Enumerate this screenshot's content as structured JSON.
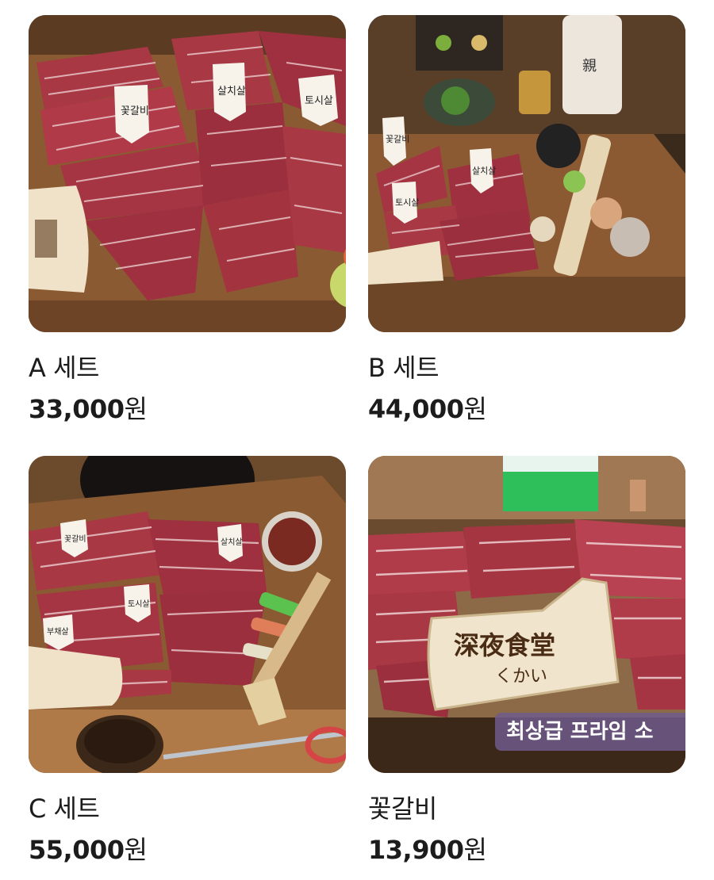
{
  "products": [
    {
      "name": "A 세트",
      "price_number": "33,000",
      "price_unit": "원",
      "photo_icon": "beef-platter-photo",
      "tags": [
        "꽃갈비",
        "살치살",
        "토시살"
      ]
    },
    {
      "name": "B 세트",
      "price_number": "44,000",
      "price_unit": "원",
      "photo_icon": "beef-platter-photo",
      "tags": [
        "꽃갈비",
        "살치살",
        "토시살"
      ]
    },
    {
      "name": "C 세트",
      "price_number": "55,000",
      "price_unit": "원",
      "photo_icon": "beef-platter-photo",
      "tags": [
        "꽃갈비",
        "살치살",
        "토시살",
        "부채살"
      ]
    },
    {
      "name": "꽃갈비",
      "price_number": "13,900",
      "price_unit": "원",
      "photo_icon": "beef-ribs-photo",
      "banner": "최상급 프라임 소",
      "mushroom_brand": "深夜食堂",
      "mushroom_sub": "くかい"
    }
  ],
  "colors": {
    "board_wood": "#8a5a32",
    "meat_red": "#a8323f",
    "marbling": "#f1d8d8",
    "text_primary": "#1c1c1c",
    "banner_bg": "#6e5a8c"
  }
}
